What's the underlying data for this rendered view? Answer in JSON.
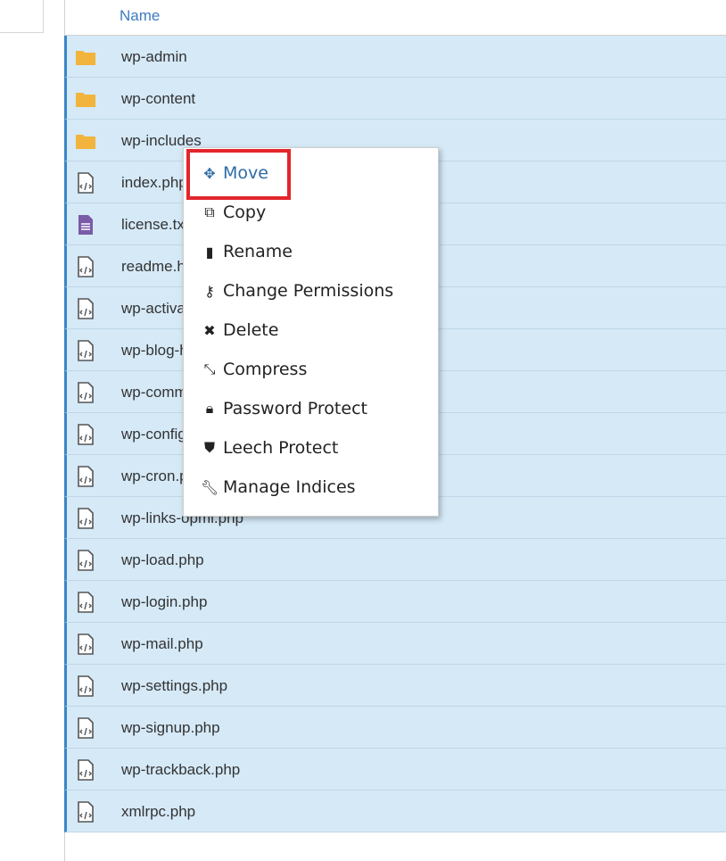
{
  "table": {
    "header": "Name",
    "rows": [
      {
        "name": "wp-admin",
        "icon": "folder-icon"
      },
      {
        "name": "wp-content",
        "icon": "folder-icon"
      },
      {
        "name": "wp-includes",
        "icon": "folder-icon"
      },
      {
        "name": "index.php",
        "icon": "code-file-icon"
      },
      {
        "name": "license.txt",
        "icon": "text-file-icon"
      },
      {
        "name": "readme.html",
        "icon": "code-file-icon"
      },
      {
        "name": "wp-activate.php",
        "icon": "code-file-icon"
      },
      {
        "name": "wp-blog-header.php",
        "icon": "code-file-icon"
      },
      {
        "name": "wp-comments-post.php",
        "icon": "code-file-icon"
      },
      {
        "name": "wp-config.php",
        "icon": "code-file-icon"
      },
      {
        "name": "wp-cron.php",
        "icon": "code-file-icon"
      },
      {
        "name": "wp-links-opml.php",
        "icon": "code-file-icon"
      },
      {
        "name": "wp-load.php",
        "icon": "code-file-icon"
      },
      {
        "name": "wp-login.php",
        "icon": "code-file-icon"
      },
      {
        "name": "wp-mail.php",
        "icon": "code-file-icon"
      },
      {
        "name": "wp-settings.php",
        "icon": "code-file-icon"
      },
      {
        "name": "wp-signup.php",
        "icon": "code-file-icon"
      },
      {
        "name": "wp-trackback.php",
        "icon": "code-file-icon"
      },
      {
        "name": "xmlrpc.php",
        "icon": "code-file-icon"
      }
    ]
  },
  "context_menu": {
    "items": [
      {
        "label": "Move",
        "icon": "move-icon"
      },
      {
        "label": "Copy",
        "icon": "copy-icon"
      },
      {
        "label": "Rename",
        "icon": "file-icon"
      },
      {
        "label": "Change Permissions",
        "icon": "key-icon"
      },
      {
        "label": "Delete",
        "icon": "close-icon"
      },
      {
        "label": "Compress",
        "icon": "compress-icon"
      },
      {
        "label": "Password Protect",
        "icon": "lock-icon"
      },
      {
        "label": "Leech Protect",
        "icon": "shield-icon"
      },
      {
        "label": "Manage Indices",
        "icon": "wrench-icon"
      }
    ]
  },
  "colors": {
    "selected_row": "#d5e9f7",
    "folder": "#f2b43c",
    "text_file": "#7a5ba8",
    "highlight": "#e3262c",
    "link": "#3d7bbf"
  }
}
